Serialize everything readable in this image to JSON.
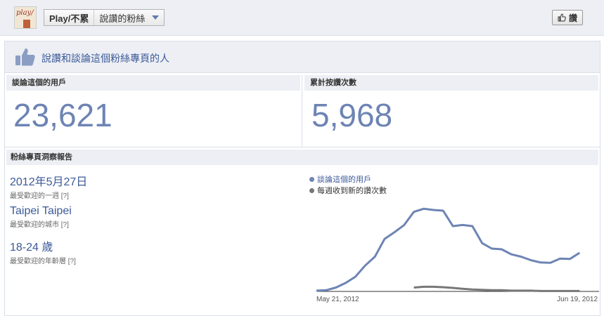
{
  "header": {
    "page_name": "Play/不累",
    "section": "說讚的粉絲",
    "like_label": "讚"
  },
  "panel": {
    "title": "說讚和談論這個粉絲專頁的人"
  },
  "stats": [
    {
      "label": "談論這個的用戶",
      "value": "23,621"
    },
    {
      "label": "累計按讚次數",
      "value": "5,968"
    }
  ],
  "report": {
    "label": "粉絲專頁洞察報告",
    "insights": [
      {
        "value": "2012年5月27日",
        "desc": "最受歡迎的一週",
        "help": "[?]"
      },
      {
        "value": "Taipei Taipei",
        "desc": "最受歡迎的城市",
        "help": "[?]"
      },
      {
        "value": "18-24 歲",
        "desc": "最受歡迎的年齡層",
        "help": "[?]"
      }
    ]
  },
  "chart_data": {
    "type": "line",
    "x_tick_labels": [
      "May 21, 2012",
      "Jun 19, 2012"
    ],
    "x": [
      "May 21, 2012",
      "May 22, 2012",
      "May 23, 2012",
      "May 24, 2012",
      "May 25, 2012",
      "May 26, 2012",
      "May 27, 2012",
      "May 28, 2012",
      "May 29, 2012",
      "May 30, 2012",
      "May 31, 2012",
      "Jun 1, 2012",
      "Jun 2, 2012",
      "Jun 3, 2012",
      "Jun 4, 2012",
      "Jun 5, 2012",
      "Jun 6, 2012",
      "Jun 7, 2012",
      "Jun 8, 2012",
      "Jun 9, 2012",
      "Jun 10, 2012",
      "Jun 11, 2012",
      "Jun 12, 2012",
      "Jun 13, 2012",
      "Jun 14, 2012",
      "Jun 15, 2012",
      "Jun 16, 2012",
      "Jun 17, 2012",
      "Jun 18, 2012",
      "Jun 19, 2012"
    ],
    "ylim": [
      0,
      24000
    ],
    "grid": false,
    "legend_position": "top-left",
    "series": [
      {
        "name": "談論這個的用戶",
        "color": "#6d84b4",
        "values": [
          200,
          300,
          1000,
          2200,
          3800,
          6700,
          9000,
          13600,
          15300,
          17200,
          20600,
          21400,
          21100,
          20900,
          16900,
          17200,
          16900,
          12500,
          11100,
          10900,
          9600,
          9000,
          8100,
          7500,
          7400,
          8500,
          8400,
          10000,
          null,
          null
        ]
      },
      {
        "name": "每週收到新的讚次數",
        "color": "#777777",
        "values": [
          null,
          null,
          null,
          null,
          null,
          null,
          null,
          null,
          null,
          null,
          1000,
          1200,
          1200,
          1100,
          900,
          700,
          500,
          400,
          300,
          300,
          200,
          200,
          200,
          100,
          100,
          100,
          100,
          100,
          null,
          null
        ]
      }
    ]
  }
}
